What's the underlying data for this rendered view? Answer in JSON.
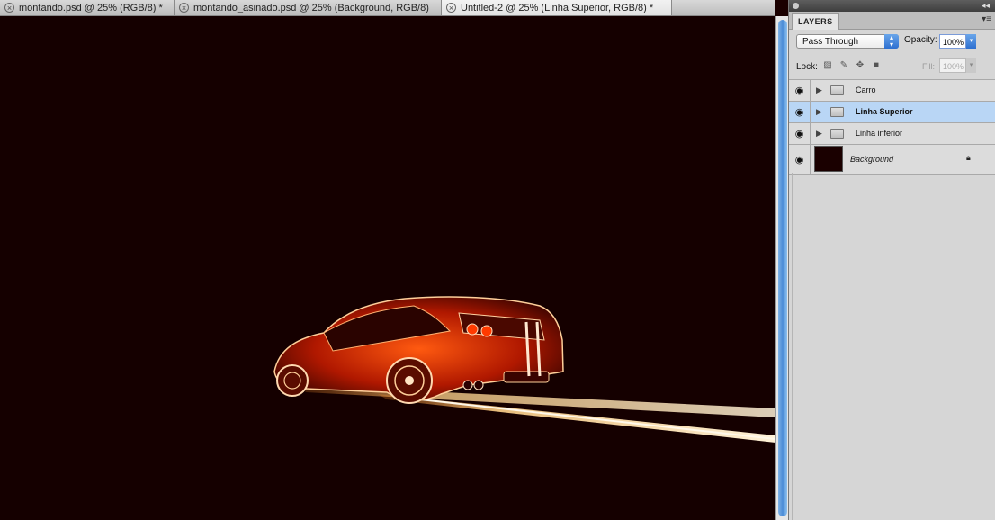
{
  "tabs": [
    {
      "label": "montando.psd @ 25% (RGB/8) *",
      "active": false
    },
    {
      "label": "montando_asinado.psd @ 25% (Background, RGB/8)",
      "active": false
    },
    {
      "label": "Untitled-2 @ 25% (Linha Superior, RGB/8) *",
      "active": true
    }
  ],
  "panel": {
    "title": "LAYERS",
    "menu_icon": "panel-menu-icon",
    "blend_mode": "Pass Through",
    "opacity_label": "Opacity:",
    "opacity_value": "100%",
    "lock_label": "Lock:",
    "fill_label": "Fill:",
    "fill_value": "100%"
  },
  "layers": [
    {
      "name": "Carro",
      "type": "group",
      "selected": false
    },
    {
      "name": "Linha Superior",
      "type": "group",
      "selected": true
    },
    {
      "name": "Linha inferior",
      "type": "group",
      "selected": false
    },
    {
      "name": "Background",
      "type": "background",
      "locked": true
    }
  ],
  "colors": {
    "canvas_bg": "#150000",
    "selection": "#b9d6f5",
    "accent": "#2d6fd0"
  }
}
